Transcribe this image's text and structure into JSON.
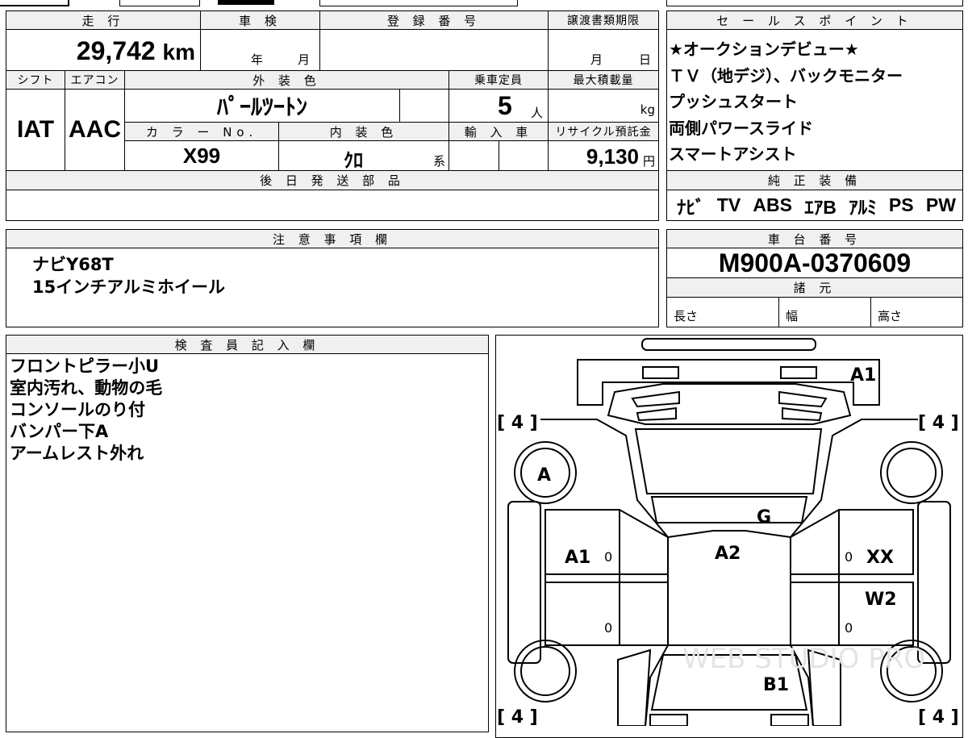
{
  "mileage": {
    "header": "走 行",
    "value": "29,742",
    "unit": "km"
  },
  "shaken": {
    "header": "車 検",
    "year_unit": "年",
    "month_unit": "月"
  },
  "registration": {
    "header": "登 録 番 号",
    "value": ""
  },
  "transfer_deadline": {
    "header": "譲渡書類期限",
    "month_unit": "月",
    "day_unit": "日"
  },
  "shift": {
    "header": "シフト",
    "value": "IAT"
  },
  "aircon": {
    "header": "エアコン",
    "value": "AAC"
  },
  "exterior_color": {
    "header": "外 装 色",
    "value": "ﾊﾟｰﾙﾂｰﾄﾝ"
  },
  "capacity": {
    "header": "乗車定員",
    "value": "5",
    "unit": "人"
  },
  "max_load": {
    "header": "最大積載量",
    "unit": "kg"
  },
  "color_no": {
    "header": "カ ラ ー No.",
    "value": "X99"
  },
  "interior_color": {
    "header": "内 装 色",
    "value": "ｸﾛ",
    "suffix": "系"
  },
  "import": {
    "header": "輸 入 車"
  },
  "recycle": {
    "header": "リサイクル預託金",
    "value": "9,130",
    "unit": "円"
  },
  "later_parts": {
    "header": "後 日 発 送 部 品"
  },
  "sales_points": {
    "header": "セ ー ル ス ポ イ ン ト",
    "items": [
      "★オークションデビュー★",
      "ＴＶ（地デジ）、バックモニター",
      "プッシュスタート",
      "両側パワースライド",
      "スマートアシスト"
    ]
  },
  "genuine_equipment": {
    "header": "純 正 装 備",
    "items": [
      "ﾅﾋﾞ",
      "TV",
      "ABS",
      "ｴｱB",
      "ｱﾙﾐ",
      "PS",
      "PW"
    ]
  },
  "notes": {
    "header": "注 意 事 項 欄",
    "lines": [
      "ナビY68T",
      "15インチアルミホイール"
    ]
  },
  "chassis": {
    "header": "車 台 番 号",
    "value": "M900A-0370609"
  },
  "specs": {
    "header": "諸 元",
    "length": "長さ",
    "width": "幅",
    "height": "高さ"
  },
  "inspector": {
    "header": "検 査 員 記 入 欄",
    "lines": [
      "フロントピラー小U",
      "室内汚れ、動物の毛",
      "コンソールのり付",
      "バンパー下A",
      "アームレスト外れ"
    ]
  },
  "diagram": {
    "tire_tl": "[ 4 ]",
    "tire_tr": "[ 4 ]",
    "tire_bl": "[ 4 ]",
    "tire_br": "[ 4 ]",
    "front_bumper": "A1",
    "front_left_wheel": "A",
    "windshield": "G",
    "roof": "A2",
    "left_front_door": "A1",
    "right_front_door": "XX",
    "right_rear_door": "W2",
    "rear": "B1",
    "zero": "0",
    "watermark": "WEB STUDIO PRO"
  }
}
